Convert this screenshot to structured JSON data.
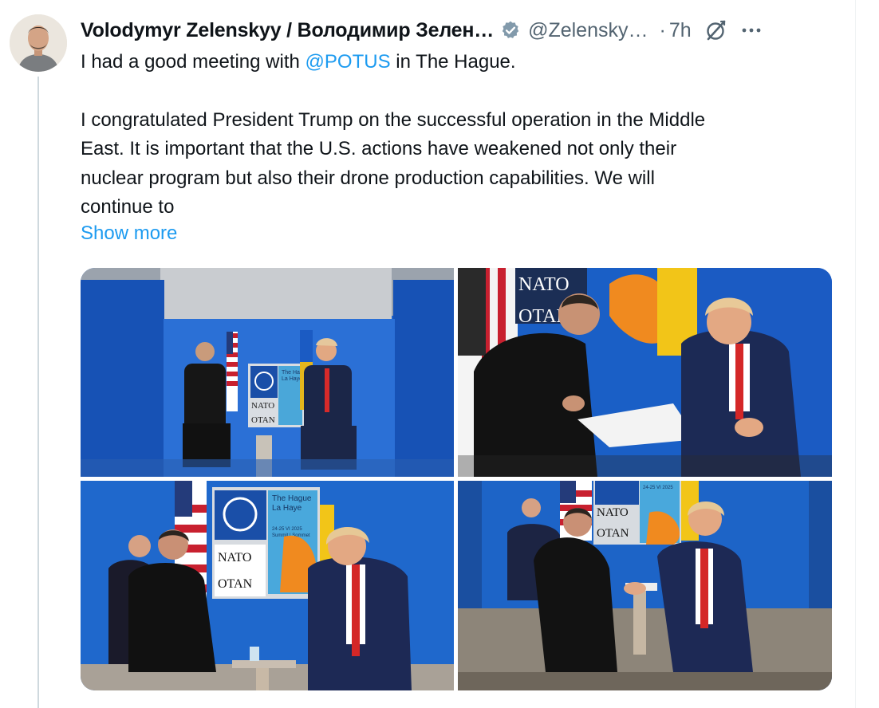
{
  "tweet": {
    "author_name": "Volodymyr Zelenskyy / Володимир Зелен…",
    "handle": "@Zelensky…",
    "separator": "·",
    "time": "7h",
    "paragraph1_before": "I had a good meeting with ",
    "mention": "@POTUS",
    "paragraph1_after": " in The Hague.",
    "paragraph2_lines": [
      "I congratulated President Trump on the successful operation in the Middle",
      "East. It is important that the U.S. actions have weakened not only their",
      "nuclear program but also their drone production capabilities. We will",
      "continue to"
    ],
    "show_more": "Show more"
  },
  "photos": {
    "photo1": {
      "backdrop_city": "The Hague",
      "backdrop_city_fr": "La Haye",
      "nato": "NATO",
      "otan": "OTAN"
    },
    "photo2": {
      "nato": "NATO",
      "otan": "OTAN"
    },
    "photo3": {
      "backdrop_city": "The Hague",
      "backdrop_city_fr": "La Haye",
      "dates": "24-25 VI 2025",
      "summit": "Summit | Sommet",
      "nato": "NATO",
      "otan": "OTAN"
    },
    "photo4": {
      "dates": "24-25 VI 2025",
      "nato": "NATO",
      "otan": "OTAN"
    }
  },
  "icons": {
    "verified": "verified-badge-icon",
    "grok": "grok-icon",
    "more": "more-icon"
  },
  "colors": {
    "accent": "#1d9bf0",
    "secondary_text": "#536471",
    "nato_blue": "#1a5bc4"
  }
}
